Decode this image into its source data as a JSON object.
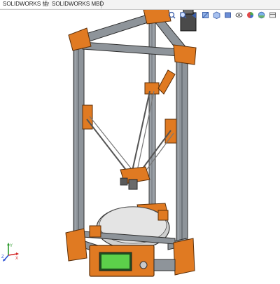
{
  "tabs": [
    {
      "label": "SOLIDWORKS 插件",
      "active": true
    },
    {
      "label": "SOLIDWORKS MBD",
      "active": false
    }
  ],
  "hud_icons": [
    "zoom-to-fit-icon",
    "zoom-area-icon",
    "previous-view-icon",
    "section-view-icon",
    "view-orientation-icon",
    "display-style-icon",
    "hide-show-icon",
    "appearance-icon",
    "scene-icon",
    "view-settings-icon"
  ],
  "triad": {
    "x": "X",
    "y": "Y",
    "z": "Z"
  },
  "colors": {
    "frame_orange": "#e07a22",
    "extrusion_gray": "#8e949a",
    "lcd_green": "#5cd04a",
    "bed": "#dcdcdc"
  }
}
